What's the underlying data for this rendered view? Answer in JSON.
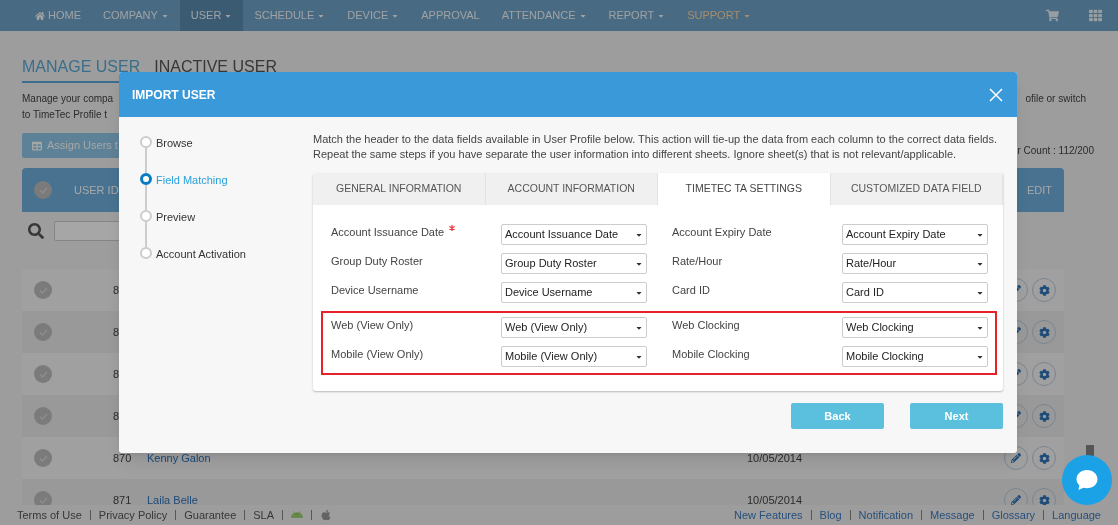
{
  "nav": {
    "items": [
      {
        "label": "HOME",
        "kind": "home",
        "selected": false
      },
      {
        "label": "COMPANY",
        "kind": "menu",
        "selected": false
      },
      {
        "label": "USER",
        "kind": "menu",
        "selected": true
      },
      {
        "label": "SCHEDULE",
        "kind": "menu",
        "selected": false
      },
      {
        "label": "DEVICE",
        "kind": "menu",
        "selected": false
      },
      {
        "label": "APPROVAL",
        "kind": "plain",
        "selected": false
      },
      {
        "label": "ATTENDANCE",
        "kind": "menu",
        "selected": false
      },
      {
        "label": "REPORT",
        "kind": "menu",
        "selected": false
      },
      {
        "label": "SUPPORT",
        "kind": "support",
        "selected": false
      }
    ]
  },
  "page_tabs": [
    {
      "label": "MANAGE USER",
      "selected": true
    },
    {
      "label": "INACTIVE USER",
      "selected": false
    }
  ],
  "description": {
    "left_lines": [
      "Manage your compa",
      "to TimeTec Profile t"
    ],
    "right_line": "ofile or switch"
  },
  "assign_button": "Assign Users t",
  "user_count": "r Count : 112/200",
  "table": {
    "columns": [
      "USER ID",
      "EDIT"
    ],
    "rows": [
      {
        "id": "8",
        "name": "",
        "date": "",
        "checked": false
      },
      {
        "id": "8",
        "name": "",
        "date": "",
        "checked": false
      },
      {
        "id": "8",
        "name": "",
        "date": "",
        "checked": false
      },
      {
        "id": "8",
        "name": "",
        "date": "",
        "checked": false
      },
      {
        "id": "870",
        "name": "Kenny Galon",
        "date": "10/05/2014",
        "checked": false
      },
      {
        "id": "871",
        "name": "Laila Belle",
        "date": "10/05/2014",
        "checked": false
      }
    ],
    "all_checked": false
  },
  "footer": {
    "left_links": [
      "Terms of Use",
      "Privacy Policy",
      "Guarantee",
      "SLA"
    ],
    "right_links": [
      "New Features",
      "Blog",
      "Notification",
      "Message",
      "Glossary",
      "Language"
    ]
  },
  "modal": {
    "title": "IMPORT USER",
    "steps": [
      {
        "label": "Browse",
        "selected": false
      },
      {
        "label": "Field Matching",
        "selected": true
      },
      {
        "label": "Preview",
        "selected": false
      },
      {
        "label": "Account Activation",
        "selected": false
      }
    ],
    "instructions": "Match the header to the data fields available in User Profile below. This action will tie-up the data from each column to the correct data fields. Repeat the same steps if you have separate the user information into different sheets. Ignore sheet(s) that is not relevant/applicable.",
    "tabs": [
      {
        "label": "GENERAL INFORMATION",
        "selected": false
      },
      {
        "label": "ACCOUNT INFORMATION",
        "selected": false
      },
      {
        "label": "TIMETEC TA SETTINGS",
        "selected": true
      },
      {
        "label": "CUSTOMIZED DATA FIELD",
        "selected": false
      }
    ],
    "field_groups": [
      {
        "highlighted": false,
        "rows": [
          {
            "left": {
              "label": "Account Issuance Date",
              "required": true,
              "value": "Account Issuance Date"
            },
            "right": {
              "label": "Account Expiry Date",
              "required": false,
              "value": "Account Expiry Date"
            }
          },
          {
            "left": {
              "label": "Group Duty Roster",
              "required": false,
              "value": "Group Duty Roster"
            },
            "right": {
              "label": "Rate/Hour",
              "required": false,
              "value": "Rate/Hour"
            }
          },
          {
            "left": {
              "label": "Device Username",
              "required": false,
              "value": "Device Username"
            },
            "right": {
              "label": "Card ID",
              "required": false,
              "value": "Card ID"
            }
          }
        ]
      },
      {
        "highlighted": true,
        "rows": [
          {
            "left": {
              "label": "Web (View Only)",
              "required": false,
              "value": "Web (View Only)"
            },
            "right": {
              "label": "Web Clocking",
              "required": false,
              "value": "Web Clocking"
            }
          },
          {
            "left": {
              "label": "Mobile (View Only)",
              "required": false,
              "value": "Mobile (View Only)"
            },
            "right": {
              "label": "Mobile Clocking",
              "required": false,
              "value": "Mobile Clocking"
            }
          }
        ]
      }
    ],
    "buttons": [
      "Back",
      "Next"
    ]
  }
}
